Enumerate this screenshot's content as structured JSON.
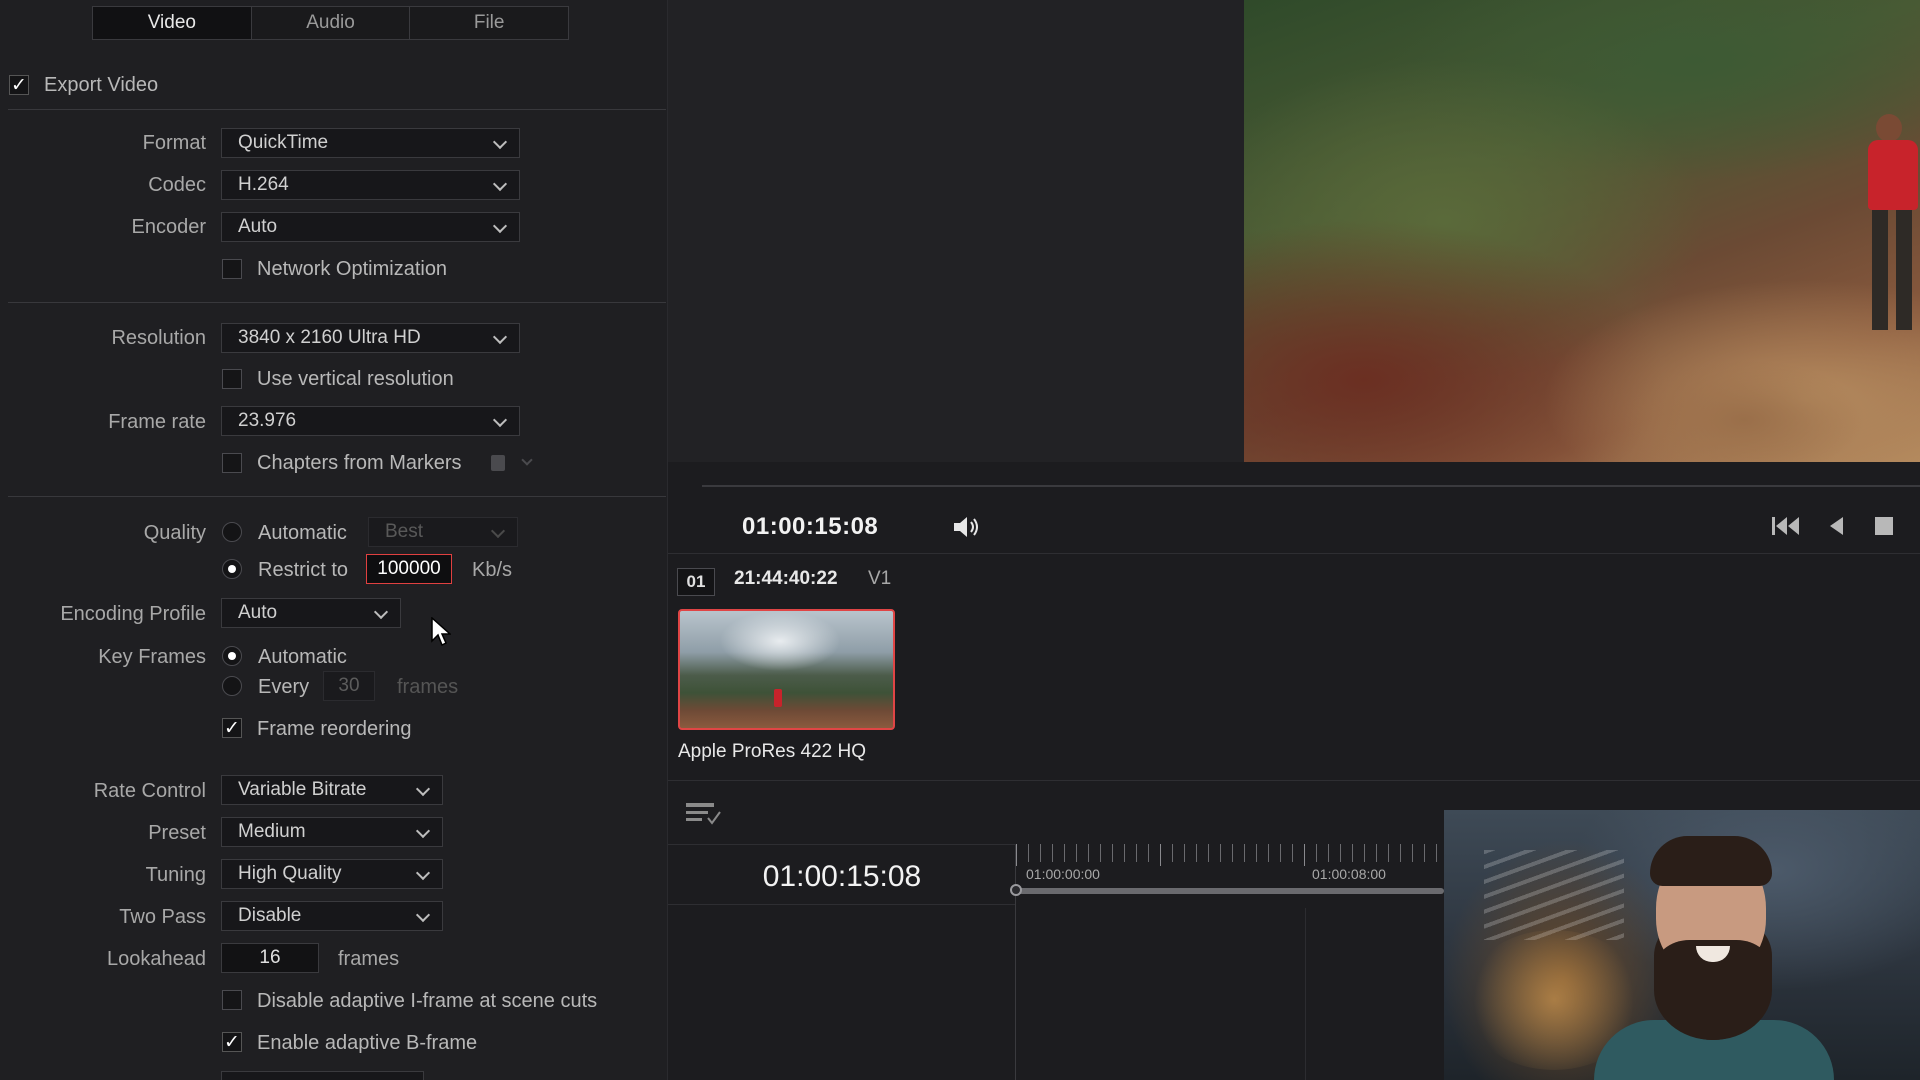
{
  "tabs": [
    {
      "label": "Video",
      "active": true
    },
    {
      "label": "Audio",
      "active": false
    },
    {
      "label": "File",
      "active": false
    }
  ],
  "export_video": {
    "label": "Export Video",
    "checked": true
  },
  "format": {
    "label": "Format",
    "value": "QuickTime"
  },
  "codec": {
    "label": "Codec",
    "value": "H.264"
  },
  "encoder": {
    "label": "Encoder",
    "value": "Auto"
  },
  "network_optimization": {
    "label": "Network Optimization",
    "checked": false
  },
  "resolution": {
    "label": "Resolution",
    "value": "3840 x 2160 Ultra HD"
  },
  "vertical_resolution": {
    "label": "Use vertical resolution",
    "checked": false
  },
  "frame_rate": {
    "label": "Frame rate",
    "value": "23.976"
  },
  "chapters": {
    "label": "Chapters from Markers",
    "checked": false
  },
  "quality": {
    "label": "Quality",
    "automatic_label": "Automatic",
    "automatic_value": "Best",
    "restrict_label": "Restrict to",
    "restrict_value": "100000",
    "unit": "Kb/s",
    "selected": "restrict"
  },
  "encoding_profile": {
    "label": "Encoding Profile",
    "value": "Auto"
  },
  "key_frames": {
    "label": "Key Frames",
    "automatic_label": "Automatic",
    "every_label": "Every",
    "every_value": "30",
    "unit": "frames",
    "selected": "automatic"
  },
  "frame_reordering": {
    "label": "Frame reordering",
    "checked": true
  },
  "rate_control": {
    "label": "Rate Control",
    "value": "Variable Bitrate"
  },
  "preset": {
    "label": "Preset",
    "value": "Medium"
  },
  "tuning": {
    "label": "Tuning",
    "value": "High Quality"
  },
  "two_pass": {
    "label": "Two Pass",
    "value": "Disable"
  },
  "lookahead": {
    "label": "Lookahead",
    "value": "16",
    "unit": "frames"
  },
  "disable_adaptive_i": {
    "label": "Disable adaptive I-frame at scene cuts",
    "checked": false
  },
  "enable_adaptive_b": {
    "label": "Enable adaptive B-frame",
    "checked": true
  },
  "viewer": {
    "timecode": "01:00:15:08"
  },
  "clip": {
    "number": "01",
    "timecode": "21:44:40:22",
    "track": "V1",
    "name": "Apple ProRes 422 HQ"
  },
  "timeline": {
    "timecode": "01:00:15:08",
    "ruler_labels": [
      "01:00:00:00",
      "01:00:08:00"
    ]
  },
  "colors": {
    "accent_red": "#e04545",
    "panel_bg": "#1f1f22",
    "text": "#c8c8c8"
  }
}
